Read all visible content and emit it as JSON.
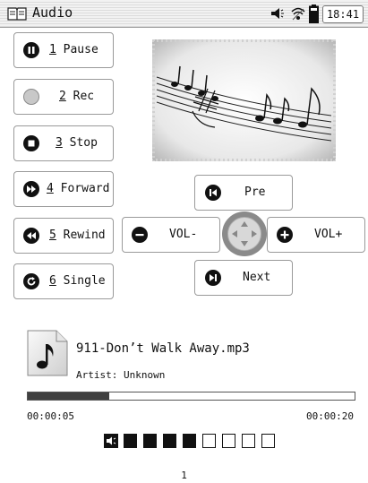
{
  "status_bar": {
    "app_title": "Audio",
    "time": "18:41",
    "icons": [
      "book-icon",
      "speaker-icon",
      "wireless-icon",
      "battery-icon"
    ]
  },
  "controls": [
    {
      "key": "1",
      "text": " Pause",
      "icon": "pause-icon"
    },
    {
      "key": "2",
      "text": " Rec",
      "icon": "record-icon"
    },
    {
      "key": "3",
      "text": " Stop",
      "icon": "stop-icon"
    },
    {
      "key": "4",
      "text": " Forward",
      "icon": "fast-forward-icon"
    },
    {
      "key": "5",
      "text": " Rewind",
      "icon": "rewind-icon"
    },
    {
      "key": "6",
      "text": " Single",
      "icon": "repeat-single-icon"
    }
  ],
  "nav": {
    "pre_label": "Pre",
    "next_label": "Next",
    "vol_down_label": "VOL-",
    "vol_up_label": "VOL+"
  },
  "track": {
    "filename": "911-Don’t Walk Away.mp3",
    "artist_line": "Artist: Unknown",
    "elapsed": "00:00:05",
    "duration": "00:00:20",
    "progress_fraction": 0.25
  },
  "volume": {
    "level": 4,
    "max": 8
  },
  "page_number": "1"
}
